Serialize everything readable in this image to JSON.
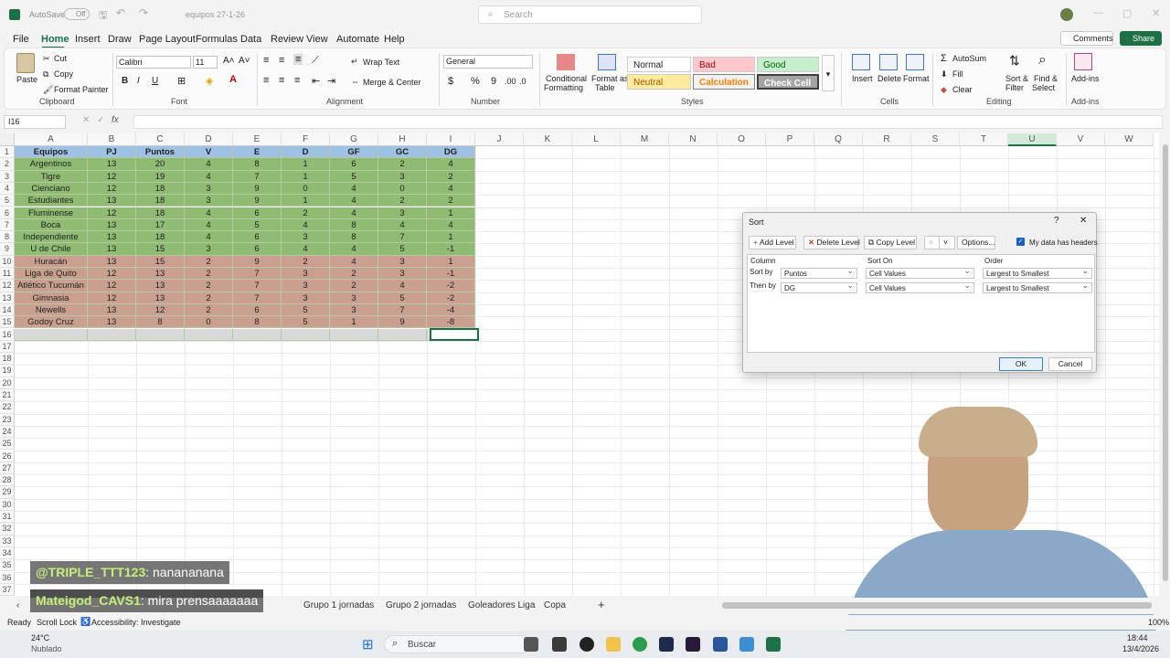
{
  "titlebar": {
    "autosave": "AutoSave",
    "autosave_state": "Off",
    "filename": "equipos 27-1-26",
    "search_placeholder": "Search"
  },
  "ribbon_tabs": [
    "File",
    "Home",
    "Insert",
    "Draw",
    "Page Layout",
    "Formulas",
    "Data",
    "Review",
    "View",
    "Automate",
    "Help"
  ],
  "share": {
    "comments": "Comments",
    "share": "Share"
  },
  "clipboard": {
    "paste": "Paste",
    "cut": "Cut",
    "copy": "Copy",
    "format_painter": "Format Painter",
    "label": "Clipboard"
  },
  "font": {
    "name": "Calibri",
    "size": "11",
    "label": "Font"
  },
  "alignment": {
    "wrap": "Wrap Text",
    "merge": "Merge & Center",
    "label": "Alignment"
  },
  "number": {
    "format": "General",
    "label": "Number"
  },
  "styles": {
    "cond": "Conditional",
    "cond2": "Formatting",
    "table": "Format as",
    "table2": "Table",
    "normal": "Normal",
    "bad": "Bad",
    "good": "Good",
    "neutral": "Neutral",
    "calculation": "Calculation",
    "check": "Check Cell",
    "label": "Styles"
  },
  "cells": {
    "insert": "Insert",
    "delete": "Delete",
    "format": "Format",
    "label": "Cells"
  },
  "editing": {
    "autosum": "AutoSum",
    "fill": "Fill",
    "clear": "Clear",
    "sort": "Sort &",
    "sort2": "Filter",
    "find": "Find &",
    "find2": "Select",
    "label": "Editing"
  },
  "addins": {
    "addins": "Add-ins",
    "label": "Add-ins"
  },
  "namebox": "I16",
  "columns": [
    "A",
    "B",
    "C",
    "D",
    "E",
    "F",
    "G",
    "H",
    "I",
    "J",
    "K",
    "L",
    "M",
    "N",
    "O",
    "P",
    "Q",
    "R",
    "S",
    "T",
    "U",
    "V",
    "W"
  ],
  "headers": [
    "Equipos",
    "PJ",
    "Puntos",
    "V",
    "E",
    "D",
    "GF",
    "GC",
    "DG"
  ],
  "rows": [
    [
      "Argentinos",
      "13",
      "20",
      "4",
      "8",
      "1",
      "6",
      "2",
      "4"
    ],
    [
      "Tigre",
      "12",
      "19",
      "4",
      "7",
      "1",
      "5",
      "3",
      "2"
    ],
    [
      "Cienciano",
      "12",
      "18",
      "3",
      "9",
      "0",
      "4",
      "0",
      "4"
    ],
    [
      "Estudiantes",
      "13",
      "18",
      "3",
      "9",
      "1",
      "4",
      "2",
      "2"
    ],
    [
      "Fluminense",
      "12",
      "18",
      "4",
      "6",
      "2",
      "4",
      "3",
      "1"
    ],
    [
      "Boca",
      "13",
      "17",
      "4",
      "5",
      "4",
      "8",
      "4",
      "4"
    ],
    [
      "Independiente",
      "13",
      "18",
      "4",
      "6",
      "3",
      "8",
      "7",
      "1"
    ],
    [
      "U de Chile",
      "13",
      "15",
      "3",
      "6",
      "4",
      "4",
      "5",
      "-1"
    ],
    [
      "Huracán",
      "13",
      "15",
      "2",
      "9",
      "2",
      "4",
      "3",
      "1"
    ],
    [
      "Liga de Quito",
      "12",
      "13",
      "2",
      "7",
      "3",
      "2",
      "3",
      "-1"
    ],
    [
      "Atlético Tucumán",
      "12",
      "13",
      "2",
      "7",
      "3",
      "2",
      "4",
      "-2"
    ],
    [
      "Gimnasia",
      "12",
      "13",
      "2",
      "7",
      "3",
      "3",
      "5",
      "-2"
    ],
    [
      "Newells",
      "13",
      "12",
      "2",
      "6",
      "5",
      "3",
      "7",
      "-4"
    ],
    [
      "Godoy Cruz",
      "13",
      "8",
      "0",
      "8",
      "5",
      "1",
      "9",
      "-8"
    ]
  ],
  "row_numbers": [
    "1",
    "2",
    "3",
    "4",
    "5",
    "6",
    "7",
    "8",
    "9",
    "10",
    "11",
    "12",
    "13",
    "14",
    "15",
    "16",
    "17",
    "18",
    "19",
    "20",
    "21",
    "22",
    "23",
    "24",
    "25",
    "26",
    "27",
    "28",
    "29",
    "30",
    "31",
    "32",
    "33",
    "34",
    "35",
    "36",
    "37"
  ],
  "colors": {
    "green": "#8fbc72",
    "rose": "#c9a08f",
    "header": "#9fc1e3",
    "accent": "#1e7145"
  },
  "dialog": {
    "title": "Sort",
    "help": "?",
    "close": "✕",
    "add_level": "Add Level",
    "delete_level": "Delete Level",
    "copy_level": "Copy Level",
    "options": "Options...",
    "has_headers": "My data has headers",
    "col_column": "Column",
    "col_sorton": "Sort On",
    "col_order": "Order",
    "levels": [
      {
        "label": "Sort by",
        "column": "Puntos",
        "sorton": "Cell Values",
        "order": "Largest to Smallest"
      },
      {
        "label": "Then by",
        "column": "DG",
        "sorton": "Cell Values",
        "order": "Largest to Smallest"
      }
    ],
    "ok": "OK",
    "cancel": "Cancel"
  },
  "sheet_tabs": [
    "Grupo 1 jornadas",
    "Grupo 2 jornadas",
    "Goleadores Liga",
    "Copa"
  ],
  "chat": [
    {
      "user": "@TRIPLE_TTT123",
      "msg": ": nanananana"
    },
    {
      "user": "Mateigod_CAVS1",
      "msg": ": mira prensaaaaaaa"
    }
  ],
  "status": {
    "ready": "Ready",
    "scroll": "Scroll Lock",
    "access": "Accessibility: Investigate",
    "zoom": "100%"
  },
  "taskbar": {
    "temp": "24°C",
    "weather": "Nublado",
    "search": "Buscar",
    "time": "18:44",
    "date": "13/4/2026"
  }
}
